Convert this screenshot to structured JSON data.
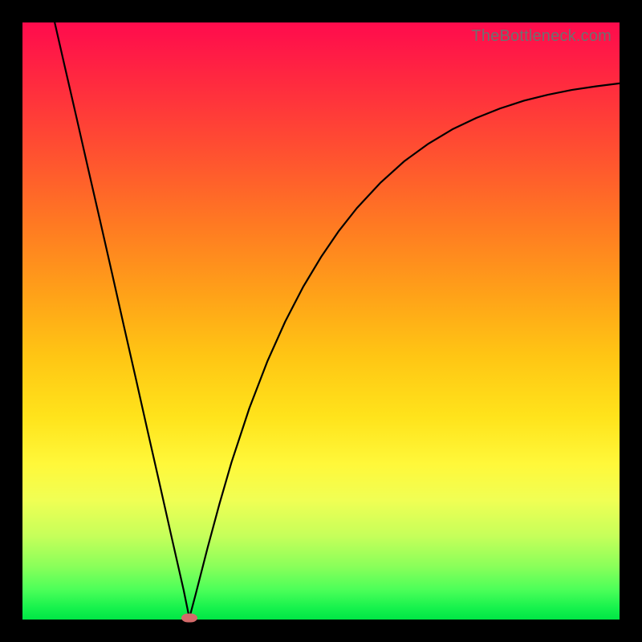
{
  "watermark": "TheBottleneck.com",
  "colors": {
    "curve": "#000000",
    "marker": "#d46a6a",
    "frame": "#000000"
  },
  "chart_data": {
    "type": "line",
    "title": "",
    "xlabel": "",
    "ylabel": "",
    "xlim": [
      0,
      100
    ],
    "ylim": [
      0,
      100
    ],
    "grid": false,
    "legend": false,
    "x": [
      5.4,
      7,
      9,
      11,
      13,
      15,
      17,
      19,
      21,
      23,
      25,
      27,
      27.95,
      29,
      31,
      33,
      35,
      38,
      41,
      44,
      47,
      50,
      53,
      56,
      60,
      64,
      68,
      72,
      76,
      80,
      84,
      88,
      92,
      96,
      100
    ],
    "y": [
      100,
      93,
      84.3,
      75.5,
      66.8,
      58,
      49.1,
      40.3,
      31.4,
      22.6,
      13.7,
      4.9,
      0.25,
      4.2,
      12,
      19.4,
      26.3,
      35.4,
      43.2,
      49.9,
      55.7,
      60.7,
      65.1,
      68.9,
      73.2,
      76.8,
      79.7,
      82.1,
      84,
      85.6,
      86.9,
      87.9,
      88.7,
      89.3,
      89.8
    ],
    "min_point": {
      "x": 27.95,
      "y": 0.25
    }
  }
}
